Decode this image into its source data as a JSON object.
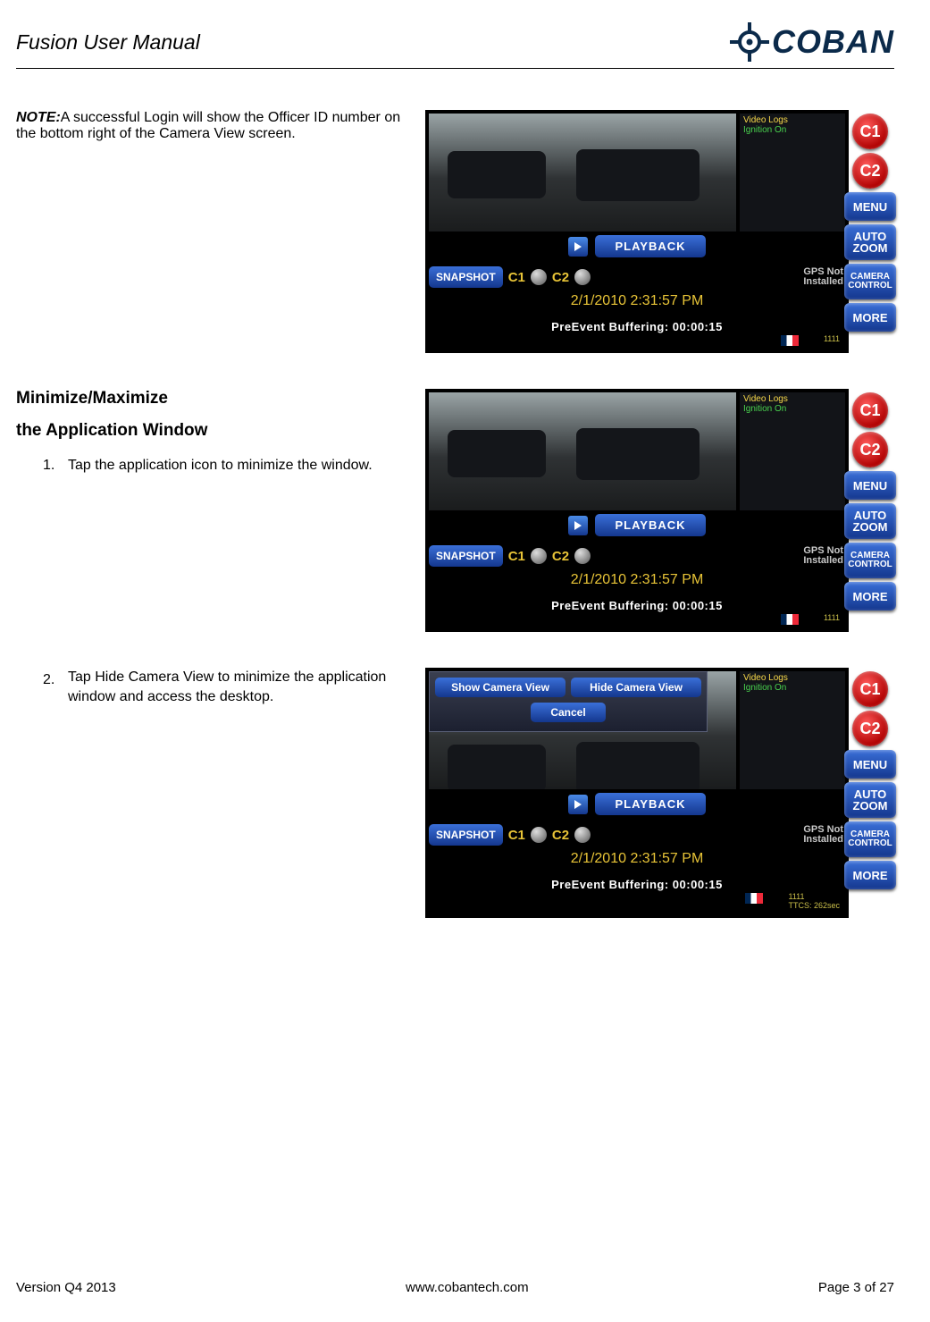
{
  "header": {
    "title": "Fusion User Manual",
    "brand": "COBAN"
  },
  "note": {
    "label": "NOTE:",
    "text": "A successful Login will show the Officer ID number on the bottom right of the Camera View screen."
  },
  "section2": {
    "h_a": "Minimize/Maximize",
    "h_b": "the Application Window",
    "step1_num": "1.",
    "step1_text": "Tap the application icon to minimize the window.",
    "step2_num": "2.",
    "step2_text": "Tap Hide Camera View to minimize the application window and access the desktop."
  },
  "shot": {
    "status1": "Video Logs",
    "status2": "Ignition On",
    "btn_c1": "C1",
    "btn_c2": "C2",
    "btn_menu": "MENU",
    "btn_autozoom": "AUTO\nZOOM",
    "btn_camctrl": "CAMERA\nCONTROL",
    "btn_more": "MORE",
    "playback": "PLAYBACK",
    "snapshot": "SNAPSHOT",
    "cam1_label": "C1",
    "cam2_label": "C2",
    "gps": "GPS Not\nInstalled",
    "timestamp": "2/1/2010 2:31:57 PM",
    "buffer": "PreEvent Buffering: 00:00:15",
    "officer_id": "1111",
    "ttcs": "TTCS: 262sec"
  },
  "dialog": {
    "show": "Show Camera View",
    "hide": "Hide Camera View",
    "cancel": "Cancel"
  },
  "footer": {
    "left": "Version Q4 2013",
    "center": "www.cobantech.com",
    "right": "Page 3 of 27"
  }
}
